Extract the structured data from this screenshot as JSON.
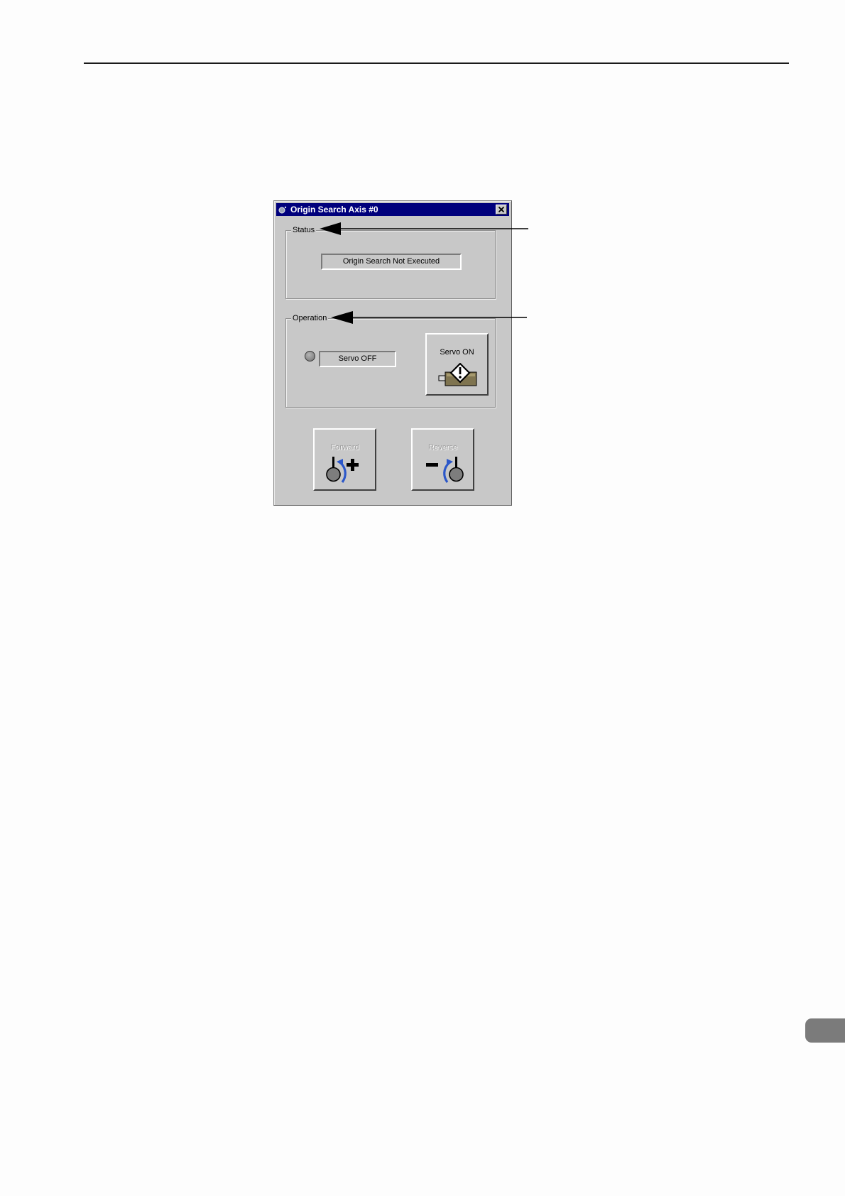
{
  "window": {
    "title": "Origin Search Axis #0",
    "icons": {
      "app": "axis-app-icon",
      "close": "close-icon"
    }
  },
  "status_group": {
    "label": "Status",
    "status_text": "Origin Search Not Executed"
  },
  "operation_group": {
    "label": "Operation",
    "servo_state": "Servo OFF",
    "lamp_icon": "status-lamp-icon",
    "servo_on_button": {
      "label": "Servo ON",
      "icon": "servo-motor-icon"
    }
  },
  "jog_buttons": {
    "forward": {
      "label": "Forward",
      "icon": "forward-jog-icon",
      "enabled": false
    },
    "reverse": {
      "label": "Reverse",
      "icon": "reverse-jog-icon",
      "enabled": false
    }
  },
  "colors": {
    "titlebar": "#00007c",
    "window_face": "#c8c8c8",
    "arrow_blue": "#2b57c9",
    "motor_body": "#7f7450"
  }
}
